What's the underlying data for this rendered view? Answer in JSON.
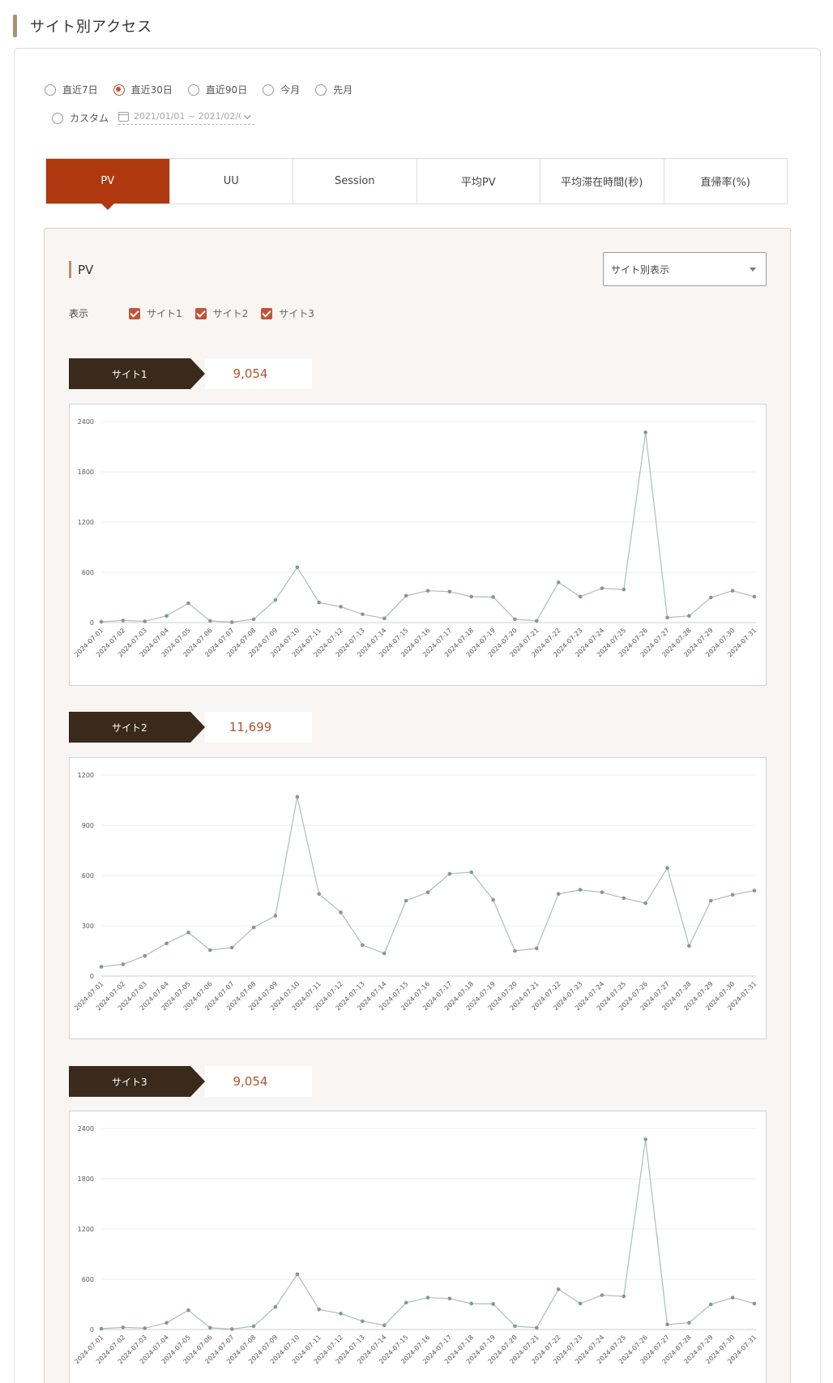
{
  "page": {
    "title": "サイト別アクセス"
  },
  "period": {
    "options": [
      "直近7日",
      "直近30日",
      "直近90日",
      "今月",
      "先月"
    ],
    "selected": "直近30日",
    "custom_label": "カスタム",
    "custom_range": "2021/01/01 ~ 2021/02/C"
  },
  "tabs": [
    "PV",
    "UU",
    "Session",
    "平均PV",
    "平均滞在時間(秒)",
    "直帰率(%)"
  ],
  "active_tab": "PV",
  "panel": {
    "title": "PV",
    "view_select": "サイト別表示",
    "show_label": "表示",
    "checkboxes": [
      "サイト1",
      "サイト2",
      "サイト3"
    ]
  },
  "colors": {
    "accent": "#b0380f",
    "banner": "#3a2a1b",
    "line": "#aebdb9",
    "point": "#7d9b92",
    "number": "#b5552f"
  },
  "sites": [
    {
      "name": "サイト1",
      "total": "9,054"
    },
    {
      "name": "サイト2",
      "total": "11,699"
    },
    {
      "name": "サイト3",
      "total": "9,054"
    }
  ],
  "chart_data": [
    {
      "type": "line",
      "title": "サイト1",
      "x": [
        "2024-07-01",
        "2024-07-02",
        "2024-07-03",
        "2024-07-04",
        "2024-07-05",
        "2024-07-06",
        "2024-07-07",
        "2024-07-08",
        "2024-07-09",
        "2024-07-10",
        "2024-07-11",
        "2024-07-12",
        "2024-07-13",
        "2024-07-14",
        "2024-07-15",
        "2024-07-16",
        "2024-07-17",
        "2024-07-18",
        "2024-07-19",
        "2024-07-20",
        "2024-07-21",
        "2024-07-22",
        "2024-07-23",
        "2024-07-24",
        "2024-07-25",
        "2024-07-26",
        "2024-07-27",
        "2024-07-28",
        "2024-07-29",
        "2024-07-30",
        "2024-07-31"
      ],
      "series": [
        {
          "values": [
            10,
            25,
            15,
            80,
            230,
            20,
            5,
            40,
            270,
            660,
            240,
            190,
            100,
            50,
            320,
            380,
            370,
            310,
            305,
            40,
            20,
            480,
            310,
            410,
            395,
            2270,
            60,
            80,
            300,
            380,
            310
          ]
        }
      ],
      "ylim": [
        0,
        2400
      ],
      "yticks": [
        0,
        600,
        1200,
        1800,
        2400
      ],
      "grid": true
    },
    {
      "type": "line",
      "title": "サイト2",
      "x": [
        "2024-07-01",
        "2024-07-02",
        "2024-07-03",
        "2024-07-04",
        "2024-07-05",
        "2024-07-06",
        "2024-07-07",
        "2024-07-08",
        "2024-07-09",
        "2024-07-10",
        "2024-07-11",
        "2024-07-12",
        "2024-07-13",
        "2024-07-14",
        "2024-07-15",
        "2024-07-16",
        "2024-07-17",
        "2024-07-18",
        "2024-07-19",
        "2024-07-20",
        "2024-07-21",
        "2024-07-22",
        "2024-07-23",
        "2024-07-24",
        "2024-07-25",
        "2024-07-26",
        "2024-07-27",
        "2024-07-28",
        "2024-07-29",
        "2024-07-30",
        "2024-07-31"
      ],
      "series": [
        {
          "values": [
            55,
            70,
            120,
            195,
            260,
            155,
            170,
            290,
            360,
            1070,
            490,
            380,
            185,
            135,
            450,
            500,
            610,
            620,
            455,
            150,
            165,
            490,
            515,
            500,
            465,
            435,
            645,
            180,
            450,
            485,
            510
          ]
        }
      ],
      "ylim": [
        0,
        1200
      ],
      "yticks": [
        0,
        300,
        600,
        900,
        1200
      ],
      "grid": true
    },
    {
      "type": "line",
      "title": "サイト3",
      "x": [
        "2024-07-01",
        "2024-07-02",
        "2024-07-03",
        "2024-07-04",
        "2024-07-05",
        "2024-07-06",
        "2024-07-07",
        "2024-07-08",
        "2024-07-09",
        "2024-07-10",
        "2024-07-11",
        "2024-07-12",
        "2024-07-13",
        "2024-07-14",
        "2024-07-15",
        "2024-07-16",
        "2024-07-17",
        "2024-07-18",
        "2024-07-19",
        "2024-07-20",
        "2024-07-21",
        "2024-07-22",
        "2024-07-23",
        "2024-07-24",
        "2024-07-25",
        "2024-07-26",
        "2024-07-27",
        "2024-07-28",
        "2024-07-29",
        "2024-07-30",
        "2024-07-31"
      ],
      "series": [
        {
          "values": [
            10,
            25,
            15,
            80,
            230,
            20,
            5,
            40,
            270,
            660,
            240,
            190,
            100,
            50,
            320,
            380,
            370,
            310,
            305,
            40,
            20,
            480,
            310,
            410,
            395,
            2270,
            60,
            80,
            300,
            380,
            310
          ]
        }
      ],
      "ylim": [
        0,
        2400
      ],
      "yticks": [
        0,
        600,
        1200,
        1800,
        2400
      ],
      "grid": true
    }
  ]
}
